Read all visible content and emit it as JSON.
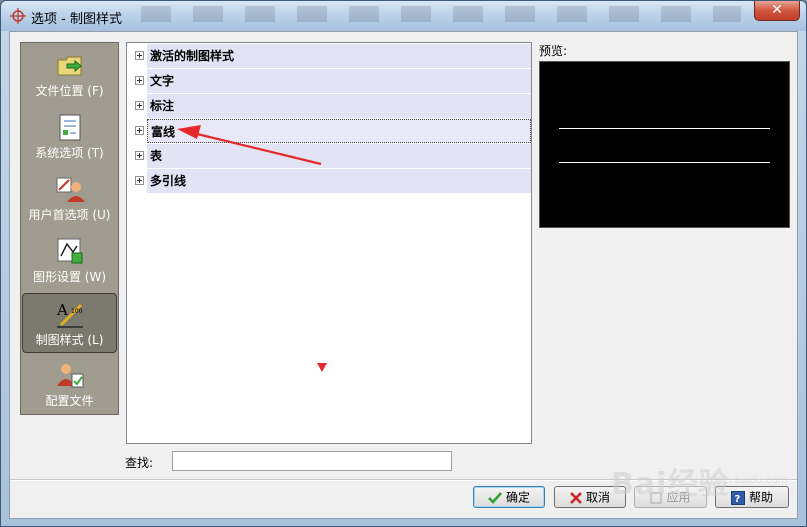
{
  "window": {
    "title": "选项 - 制图样式",
    "close_label": "✕"
  },
  "nav": {
    "items": [
      {
        "label": "文件位置 (F)",
        "icon": "folder-icon",
        "active": false
      },
      {
        "label": "系统选项 (T)",
        "icon": "checklist-icon",
        "active": false
      },
      {
        "label": "用户首选项 (U)",
        "icon": "user-prefs-icon",
        "active": false
      },
      {
        "label": "图形设置 (W)",
        "icon": "graphics-icon",
        "active": false
      },
      {
        "label": "制图样式 (L)",
        "icon": "drafting-style-icon",
        "active": true
      },
      {
        "label": "配置文件",
        "icon": "profile-icon",
        "active": false
      }
    ]
  },
  "tree": {
    "items": [
      {
        "label": "激活的制图样式",
        "selected": false
      },
      {
        "label": "文字",
        "selected": false
      },
      {
        "label": "标注",
        "selected": false
      },
      {
        "label": "富线",
        "selected": true
      },
      {
        "label": "表",
        "selected": false
      },
      {
        "label": "多引线",
        "selected": false
      }
    ]
  },
  "preview": {
    "label": "预览:"
  },
  "search": {
    "label": "查找:",
    "value": "",
    "placeholder": ""
  },
  "buttons": {
    "ok": "确定",
    "cancel": "取消",
    "apply": "应用",
    "help": "帮助"
  },
  "watermark": {
    "text": "Bai经验",
    "sub": "jingyan.baidu.com"
  },
  "colors": {
    "tree_highlight": "#e3e3f6",
    "nav_bg": "#a09c90",
    "annotation": "#e8292b"
  }
}
